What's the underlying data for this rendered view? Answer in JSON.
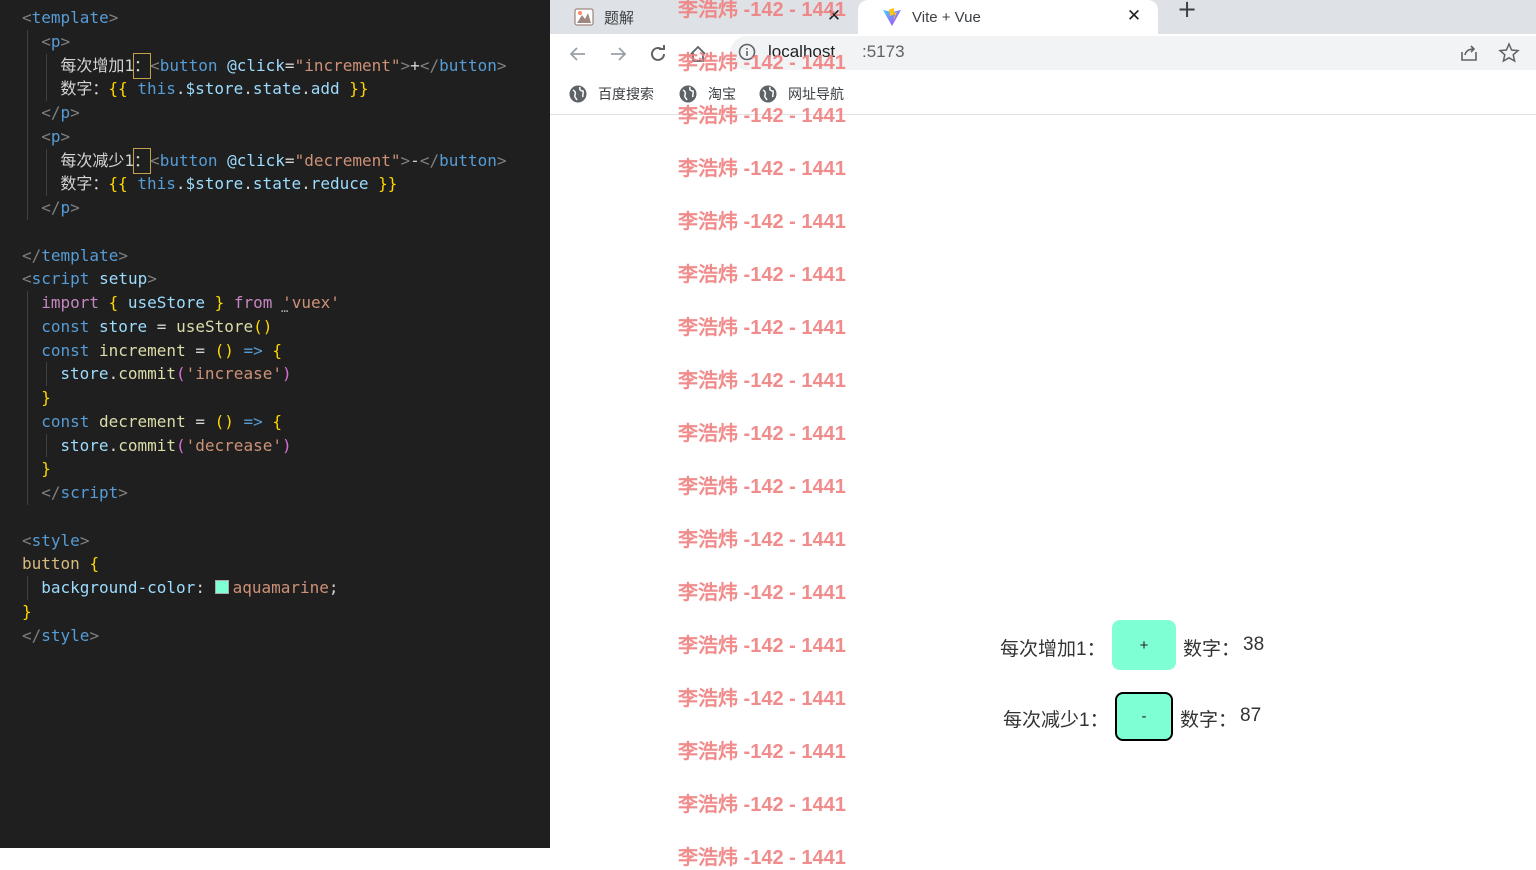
{
  "editor": {
    "lines": [
      {
        "tokens": [
          [
            "tk-br",
            "<"
          ],
          [
            "tk-tag",
            "template"
          ],
          [
            "tk-br",
            ">"
          ]
        ]
      },
      {
        "tokens": [
          [
            "tk-br",
            "<"
          ],
          [
            "tk-tag",
            "p"
          ],
          [
            "tk-br",
            ">"
          ]
        ]
      },
      {
        "tokens": [
          [
            "tk-txt",
            "每次增加1"
          ],
          [
            "sel",
            "："
          ],
          [
            "tk-br",
            "<"
          ],
          [
            "tk-tag",
            "button"
          ],
          [
            "tk-txt",
            " "
          ],
          [
            "tk-attr",
            "@click"
          ],
          [
            "tk-txt",
            "="
          ],
          [
            "tk-str",
            "\"increment\""
          ],
          [
            "tk-br",
            ">"
          ],
          [
            "tk-txt",
            "+"
          ],
          [
            "tk-br",
            "</"
          ],
          [
            "tk-tag",
            "button"
          ],
          [
            "tk-br",
            ">"
          ]
        ]
      },
      {
        "tokens": [
          [
            "tk-txt",
            "数字："
          ],
          [
            "tk-gold",
            "{{ "
          ],
          [
            "tk-this",
            "this"
          ],
          [
            "tk-txt",
            "."
          ],
          [
            "tk-prop",
            "$store"
          ],
          [
            "tk-txt",
            "."
          ],
          [
            "tk-prop",
            "state"
          ],
          [
            "tk-txt",
            "."
          ],
          [
            "tk-prop",
            "add"
          ],
          [
            "tk-gold",
            " }}"
          ]
        ]
      },
      {
        "tokens": [
          [
            "tk-br",
            "</"
          ],
          [
            "tk-tag",
            "p"
          ],
          [
            "tk-br",
            ">"
          ]
        ]
      },
      {
        "tokens": [
          [
            "tk-br",
            "<"
          ],
          [
            "tk-tag",
            "p"
          ],
          [
            "tk-br",
            ">"
          ]
        ]
      },
      {
        "tokens": [
          [
            "tk-txt",
            "每次减少1"
          ],
          [
            "sel",
            "："
          ],
          [
            "tk-br",
            "<"
          ],
          [
            "tk-tag",
            "button"
          ],
          [
            "tk-txt",
            " "
          ],
          [
            "tk-attr",
            "@click"
          ],
          [
            "tk-txt",
            "="
          ],
          [
            "tk-str",
            "\"decrement\""
          ],
          [
            "tk-br",
            ">"
          ],
          [
            "tk-txt",
            "-"
          ],
          [
            "tk-br",
            "</"
          ],
          [
            "tk-tag",
            "button"
          ],
          [
            "tk-br",
            ">"
          ]
        ]
      },
      {
        "tokens": [
          [
            "tk-txt",
            "数字："
          ],
          [
            "tk-gold",
            "{{ "
          ],
          [
            "tk-this",
            "this"
          ],
          [
            "tk-txt",
            "."
          ],
          [
            "tk-prop",
            "$store"
          ],
          [
            "tk-txt",
            "."
          ],
          [
            "tk-prop",
            "state"
          ],
          [
            "tk-txt",
            "."
          ],
          [
            "tk-prop",
            "reduce"
          ],
          [
            "tk-gold",
            " }}"
          ]
        ]
      },
      {
        "tokens": [
          [
            "tk-br",
            "</"
          ],
          [
            "tk-tag",
            "p"
          ],
          [
            "tk-br",
            ">"
          ]
        ]
      },
      {
        "tokens": []
      },
      {
        "tokens": [
          [
            "tk-br",
            "</"
          ],
          [
            "tk-tag",
            "template"
          ],
          [
            "tk-br",
            ">"
          ]
        ]
      },
      {
        "tokens": [
          [
            "tk-br",
            "<"
          ],
          [
            "tk-tag",
            "script"
          ],
          [
            "tk-txt",
            " "
          ],
          [
            "tk-attr",
            "setup"
          ],
          [
            "tk-br",
            ">"
          ]
        ]
      },
      {
        "tokens": [
          [
            "tk-kw",
            "import"
          ],
          [
            "tk-txt",
            " "
          ],
          [
            "tk-gold",
            "{"
          ],
          [
            "tk-txt",
            " "
          ],
          [
            "tk-var",
            "useStore"
          ],
          [
            "tk-txt",
            " "
          ],
          [
            "tk-gold",
            "}"
          ],
          [
            "tk-txt",
            " "
          ],
          [
            "tk-kw",
            "from"
          ],
          [
            "tk-txt",
            " "
          ],
          [
            "tk-str",
            "'vuex'"
          ]
        ]
      },
      {
        "tokens": [
          [
            "tk-decl",
            "const"
          ],
          [
            "tk-txt",
            " "
          ],
          [
            "tk-var",
            "store"
          ],
          [
            "tk-txt",
            " = "
          ],
          [
            "tk-fn",
            "useStore"
          ],
          [
            "tk-gold",
            "()"
          ]
        ]
      },
      {
        "tokens": [
          [
            "tk-decl",
            "const"
          ],
          [
            "tk-txt",
            " "
          ],
          [
            "tk-fn",
            "increment"
          ],
          [
            "tk-txt",
            " = "
          ],
          [
            "tk-gold",
            "()"
          ],
          [
            "tk-txt",
            " "
          ],
          [
            "tk-arrow",
            "=>"
          ],
          [
            "tk-txt",
            " "
          ],
          [
            "tk-gold",
            "{"
          ]
        ]
      },
      {
        "tokens": [
          [
            "tk-var",
            "store"
          ],
          [
            "tk-txt",
            "."
          ],
          [
            "tk-fn",
            "commit"
          ],
          [
            "tk-pink",
            "("
          ],
          [
            "tk-str",
            "'increase'"
          ],
          [
            "tk-pink",
            ")"
          ]
        ]
      },
      {
        "tokens": [
          [
            "tk-gold",
            "}"
          ]
        ]
      },
      {
        "tokens": [
          [
            "tk-decl",
            "const"
          ],
          [
            "tk-txt",
            " "
          ],
          [
            "tk-fn",
            "decrement"
          ],
          [
            "tk-txt",
            " = "
          ],
          [
            "tk-gold",
            "()"
          ],
          [
            "tk-txt",
            " "
          ],
          [
            "tk-arrow",
            "=>"
          ],
          [
            "tk-txt",
            " "
          ],
          [
            "tk-gold",
            "{"
          ]
        ]
      },
      {
        "tokens": [
          [
            "tk-var",
            "store"
          ],
          [
            "tk-txt",
            "."
          ],
          [
            "tk-fn",
            "commit"
          ],
          [
            "tk-pink",
            "("
          ],
          [
            "tk-str",
            "'decrease'"
          ],
          [
            "tk-pink",
            ")"
          ]
        ]
      },
      {
        "tokens": [
          [
            "tk-gold",
            "}"
          ]
        ]
      },
      {
        "tokens": [
          [
            "tk-br",
            "</"
          ],
          [
            "tk-tag",
            "script"
          ],
          [
            "tk-br",
            ">"
          ]
        ]
      },
      {
        "tokens": []
      },
      {
        "tokens": [
          [
            "tk-br",
            "<"
          ],
          [
            "tk-tag",
            "style"
          ],
          [
            "tk-br",
            ">"
          ]
        ]
      },
      {
        "tokens": [
          [
            "tk-sel",
            "button"
          ],
          [
            "tk-txt",
            " "
          ],
          [
            "tk-gold",
            "{"
          ]
        ]
      },
      {
        "tokens": [
          [
            "tk-cssprop",
            "background-color"
          ],
          [
            "tk-txt",
            ": "
          ],
          [
            "swatch",
            ""
          ],
          [
            "tk-cssval",
            "aquamarine"
          ],
          [
            "tk-txt",
            ";"
          ]
        ]
      },
      {
        "tokens": [
          [
            "tk-gold",
            "}"
          ]
        ]
      },
      {
        "tokens": [
          [
            "tk-br",
            "</"
          ],
          [
            "tk-tag",
            "style"
          ],
          [
            "tk-br",
            ">"
          ]
        ]
      }
    ],
    "swatch_color": "#7fffd4"
  },
  "browser": {
    "tabs": [
      {
        "title": "题解",
        "icon": "tab-favicon-icon",
        "close": "✕"
      },
      {
        "title": "Vite + Vue",
        "icon": "vite-logo-icon",
        "close": "✕"
      }
    ],
    "new_tab": "+",
    "url_host": "localhost",
    "url_port": ":5173",
    "bookmarks": [
      "百度搜索",
      "淘宝",
      "网址导航"
    ]
  },
  "watermark": {
    "text": "李浩炜 -142 - 1441",
    "color": "#f08080"
  },
  "app": {
    "increment_label": "每次增加1：",
    "increment_button": "+",
    "add_label": "数字：",
    "add_value": "38",
    "decrement_label": "每次减少1：",
    "decrement_button": "-",
    "reduce_label": "数字：",
    "reduce_value": "87",
    "button_color": "#7fffd4"
  }
}
